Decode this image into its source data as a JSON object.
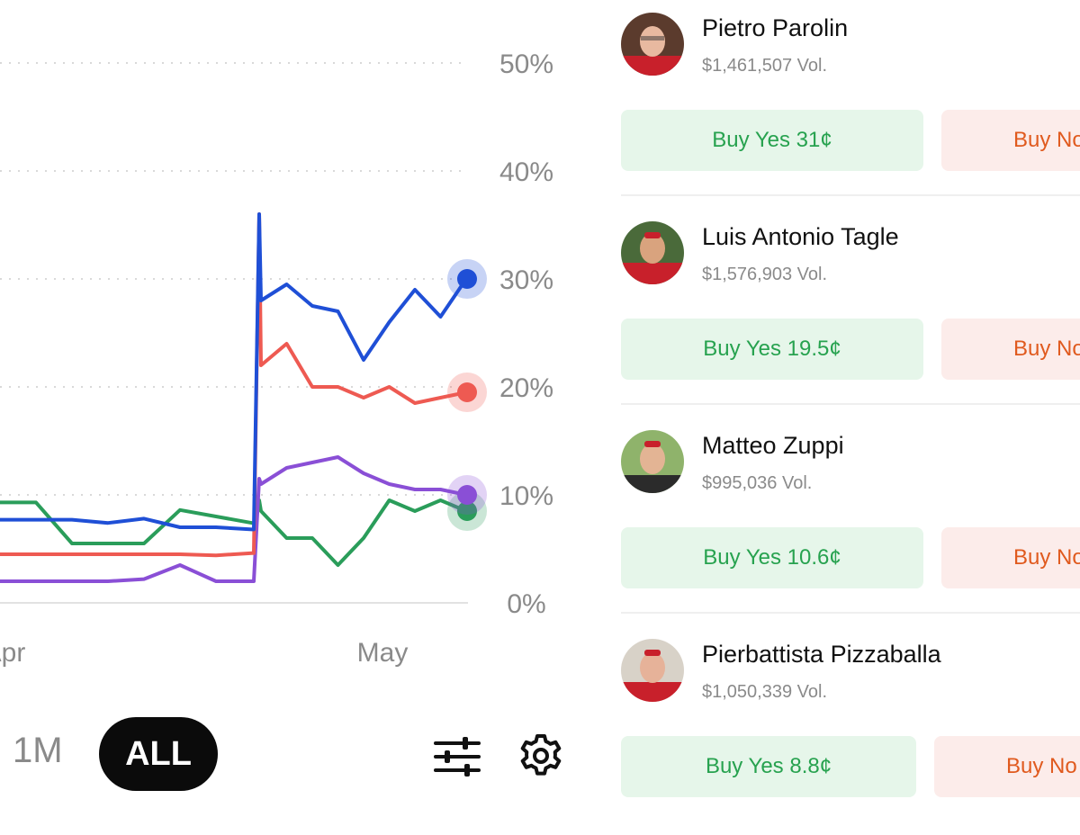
{
  "chart": {
    "y_ticks": [
      "50%",
      "40%",
      "30%",
      "20%",
      "10%",
      "0%"
    ],
    "x_labels": [
      "Apr",
      "May"
    ],
    "colors": {
      "blue": "#1f4fd6",
      "red": "#ee5a52",
      "purple": "#8a4fd6",
      "green": "#2a9d5a",
      "grid": "#d9d9d9"
    }
  },
  "chart_data": {
    "type": "line",
    "ylim": [
      0,
      50
    ],
    "y_unit": "%",
    "x": [
      "Apr",
      "May"
    ],
    "series": [
      {
        "color": "#1f4fd6",
        "values": [
          7.7,
          7.7,
          7.7,
          7.4,
          7.8,
          7.0,
          7.0,
          6.8,
          36.0,
          28.0,
          29.5,
          27.5,
          27.0,
          22.5,
          26.0,
          29.0,
          26.5,
          30.0
        ]
      },
      {
        "color": "#ee5a52",
        "values": [
          4.5,
          4.5,
          4.5,
          4.5,
          4.5,
          4.5,
          4.4,
          4.6,
          36.0,
          22.0,
          24.0,
          20.0,
          20.0,
          19.0,
          20.0,
          18.5,
          19.0,
          19.5
        ]
      },
      {
        "color": "#8a4fd6",
        "values": [
          2.0,
          2.0,
          2.0,
          2.0,
          2.2,
          3.5,
          2.0,
          2.0,
          11.5,
          11.0,
          12.5,
          13.0,
          13.5,
          12.0,
          11.0,
          10.5,
          10.5,
          10.0
        ]
      },
      {
        "color": "#2a9d5a",
        "values": [
          9.3,
          9.3,
          5.5,
          5.5,
          5.5,
          8.6,
          8.0,
          7.4,
          9.5,
          8.5,
          6.0,
          6.0,
          3.5,
          6.0,
          9.5,
          8.5,
          9.5,
          8.5
        ]
      }
    ]
  },
  "controls": {
    "range_1m": "1M",
    "range_all": "ALL"
  },
  "candidates": [
    {
      "name": "Pietro Parolin",
      "volume": "$1,461,507 Vol.",
      "yes": "Buy Yes 31¢",
      "no": "Buy No"
    },
    {
      "name": "Luis Antonio Tagle",
      "volume": "$1,576,903 Vol.",
      "yes": "Buy Yes 19.5¢",
      "no": "Buy No"
    },
    {
      "name": "Matteo Zuppi",
      "volume": "$995,036 Vol.",
      "yes": "Buy Yes 10.6¢",
      "no": "Buy No"
    },
    {
      "name": "Pierbattista Pizzaballa",
      "volume": "$1,050,339 Vol.",
      "yes": "Buy Yes 8.8¢",
      "no": "Buy No"
    }
  ]
}
